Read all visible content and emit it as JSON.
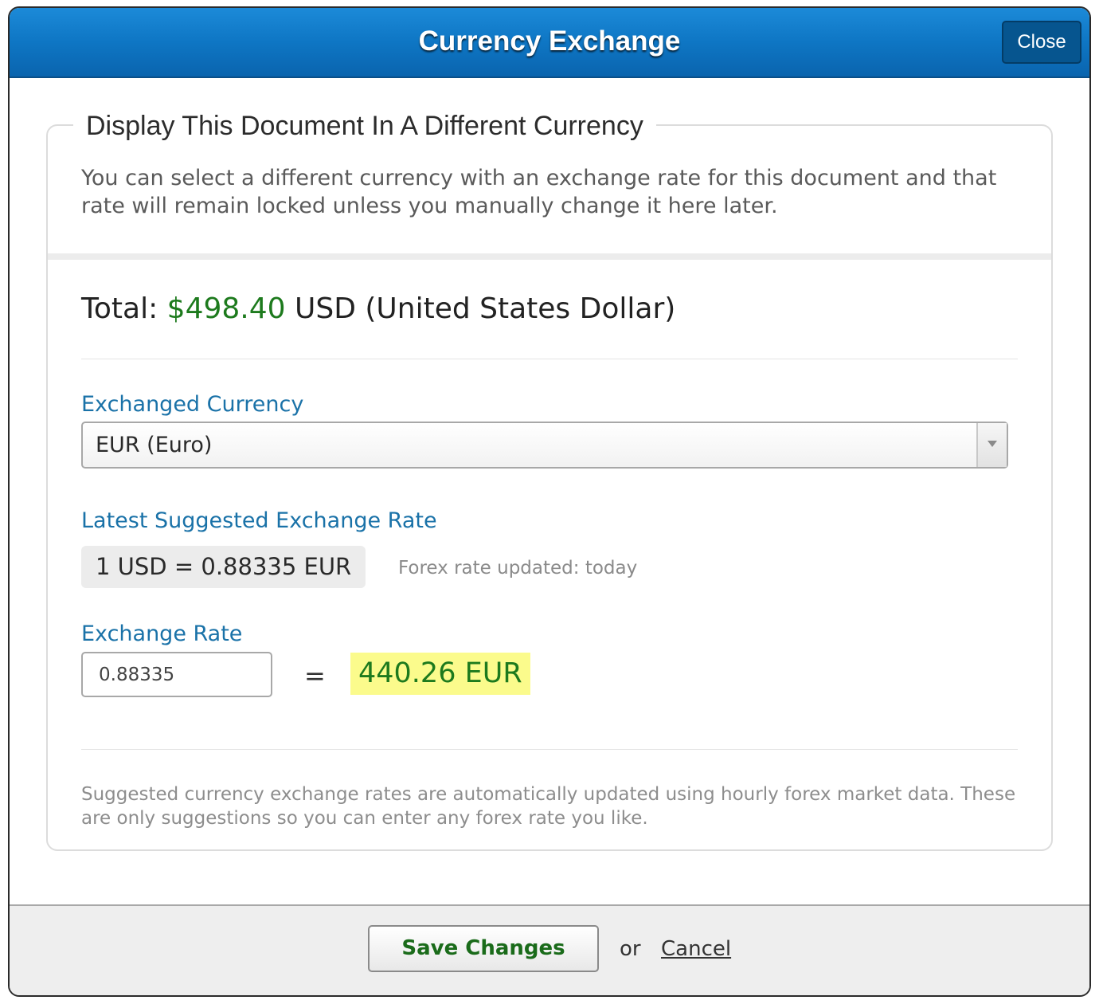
{
  "dialog": {
    "title": "Currency Exchange",
    "close_label": "Close"
  },
  "section": {
    "legend": "Display This Document In A Different Currency",
    "intro": "You can select a different currency with an exchange rate for this document and that rate will remain locked unless you manually change it here later."
  },
  "total": {
    "label": "Total:",
    "amount": "$498.40",
    "currency": "USD (United States Dollar)"
  },
  "exchanged_currency": {
    "label": "Exchanged Currency",
    "selected": "EUR (Euro)"
  },
  "suggested_rate": {
    "label": "Latest Suggested Exchange Rate",
    "value": "1 USD = 0.88335 EUR",
    "updated_text": "Forex rate updated: today"
  },
  "exchange_rate": {
    "label": "Exchange Rate",
    "input_value": "0.88335",
    "equals": "=",
    "converted": "440.26 EUR"
  },
  "footnote": "Suggested currency exchange rates are automatically updated using hourly forex market data. These are only suggestions so you can enter any forex rate you like.",
  "footer": {
    "save_label": "Save Changes",
    "or_text": "or",
    "cancel_label": "Cancel"
  },
  "icons": {
    "select_arrow": "chevron-down-icon"
  },
  "colors": {
    "titlebar": "#0e76c4",
    "label_blue": "#1a72a8",
    "money_green": "#1d7a1d",
    "highlight": "#fbfb8c"
  }
}
